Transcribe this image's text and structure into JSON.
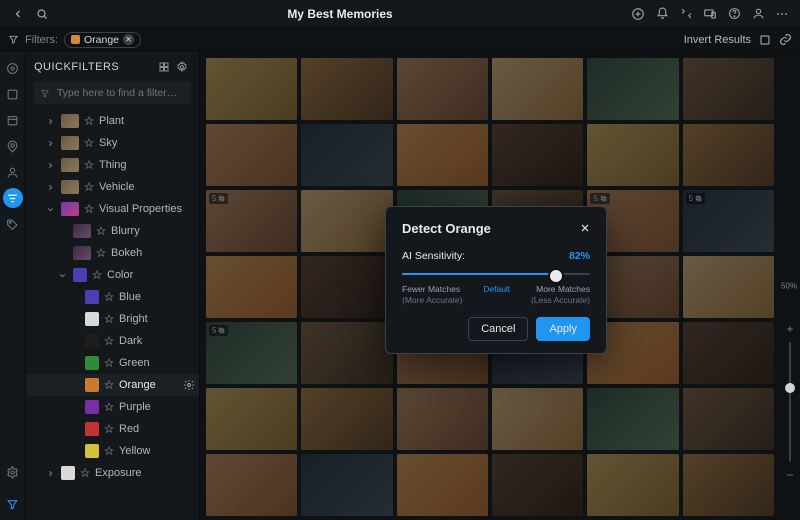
{
  "topbar": {
    "title": "My Best Memories"
  },
  "filters": {
    "label": "Filters:",
    "chip_label": "Orange",
    "invert_label": "Invert Results"
  },
  "panel": {
    "heading": "QUICKFILTERS",
    "search_placeholder": "Type here to find a filter…"
  },
  "tree": {
    "categories": [
      {
        "label": "Plant"
      },
      {
        "label": "Sky"
      },
      {
        "label": "Thing"
      },
      {
        "label": "Vehicle"
      }
    ],
    "visual_properties_label": "Visual Properties",
    "vp_items": [
      {
        "label": "Blurry"
      },
      {
        "label": "Bokeh"
      }
    ],
    "color_label": "Color",
    "colors": [
      {
        "label": "Blue",
        "hex": "#4a3fb5"
      },
      {
        "label": "Bright",
        "hex": "#d9d9d9"
      },
      {
        "label": "Dark",
        "hex": "#1d1d1d"
      },
      {
        "label": "Green",
        "hex": "#2e8b3a"
      },
      {
        "label": "Orange",
        "hex": "#c97a2e"
      },
      {
        "label": "Purple",
        "hex": "#7a2ea8"
      },
      {
        "label": "Red",
        "hex": "#c23434"
      },
      {
        "label": "Yellow",
        "hex": "#d6c23a"
      }
    ],
    "exposure_label": "Exposure"
  },
  "grid": {
    "stack_badges": [
      "5",
      "5",
      "5",
      "5"
    ],
    "zoom_label": "50%"
  },
  "dialog": {
    "title": "Detect Orange",
    "sensitivity_label": "AI Sensitivity:",
    "sensitivity_value": "82%",
    "sensitivity_percent": 82,
    "ticks_left_1": "Fewer Matches",
    "ticks_left_2": "(More Accurate)",
    "ticks_mid": "Default",
    "ticks_right_1": "More Matches",
    "ticks_right_2": "(Less Accurate)",
    "cancel": "Cancel",
    "apply": "Apply"
  }
}
